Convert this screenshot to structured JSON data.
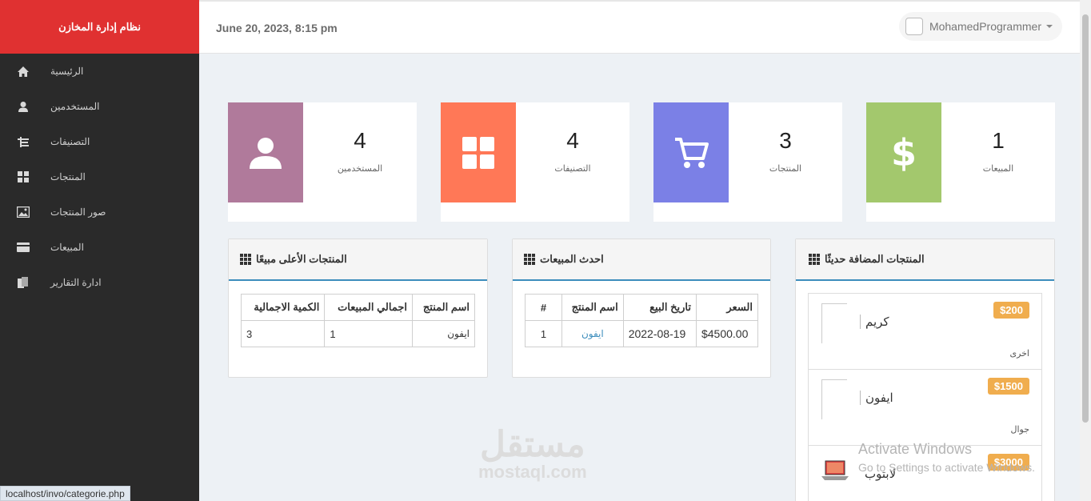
{
  "brand": "نظام إدارة المخازن",
  "header": {
    "date": "June 20, 2023, 8:15 pm",
    "username": "MohamedProgrammer"
  },
  "sidebar": {
    "items": [
      {
        "label": "الرئيسية",
        "icon": "home-icon"
      },
      {
        "label": "المستخدمين",
        "icon": "user-icon"
      },
      {
        "label": "التصنيفات",
        "icon": "categories-icon"
      },
      {
        "label": "المنتجات",
        "icon": "grid-icon"
      },
      {
        "label": "صور المنتجات",
        "icon": "image-icon"
      },
      {
        "label": "المبيعات",
        "icon": "card-icon"
      },
      {
        "label": "ادارة التقارير",
        "icon": "reports-icon"
      }
    ]
  },
  "stats": [
    {
      "value": "4",
      "label": "المستخدمين",
      "color": "#b07a9b",
      "icon": "user-icon"
    },
    {
      "value": "4",
      "label": "التصنيفات",
      "color": "#ff7857",
      "icon": "grid-icon"
    },
    {
      "value": "3",
      "label": "المنتجات",
      "color": "#7b80e6",
      "icon": "cart-icon"
    },
    {
      "value": "1",
      "label": "المبيعات",
      "color": "#a3c86d",
      "icon": "dollar-icon"
    }
  ],
  "top_selling": {
    "title": "المنتجات الأعلى مبيعًا",
    "headers": [
      "الكمية الاجمالية",
      "اجمالي المبيعات",
      "اسم المنتج"
    ],
    "rows": [
      [
        "3",
        "1",
        "ايفون"
      ]
    ]
  },
  "latest_sales": {
    "title": "احدث المبيعات",
    "headers": [
      "السعر",
      "تاريخ البيع",
      "اسم المنتج",
      "#"
    ],
    "rows": [
      [
        "$4500.00",
        "2022-08-19",
        "ايفون",
        "1"
      ]
    ]
  },
  "recent_products": {
    "title": "المنتجات المضافة حديثًا",
    "items": [
      {
        "name": "كريم",
        "price": "$200",
        "category": "اخرى"
      },
      {
        "name": "ايفون",
        "price": "$1500",
        "category": "جوال"
      },
      {
        "name": "لابتوب",
        "price": "$3000",
        "category": ""
      }
    ]
  },
  "overlay": {
    "activate_title": "Activate Windows",
    "activate_sub": "Go to Settings to activate Windows.",
    "watermark_ar": "مستقل",
    "watermark_en": "mostaql.com",
    "status_url": "localhost/invo/categorie.php"
  }
}
